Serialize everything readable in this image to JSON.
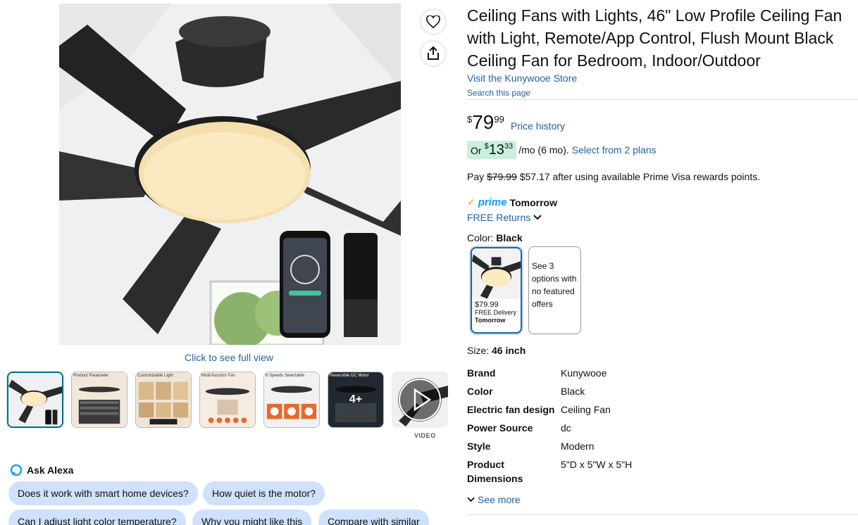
{
  "media": {
    "click_full_view": "Click to see full view",
    "thumbnails": [
      {
        "caption": ""
      },
      {
        "caption": "Product Parameter"
      },
      {
        "caption": "Customizable Light"
      },
      {
        "caption": "Multi-function Fan"
      },
      {
        "caption": "6 Speeds Selectable"
      },
      {
        "caption": "Reversible DC Motor",
        "overlay": "4+"
      },
      {
        "caption": ""
      }
    ],
    "video_label": "VIDEO"
  },
  "alexa": {
    "title": "Ask Alexa",
    "chips": [
      "Does it work with smart home devices?",
      "How quiet is the motor?",
      "Can I adjust light color temperature?",
      "Why you might like this",
      "Compare with similar"
    ]
  },
  "product": {
    "title": "Ceiling Fans with Lights, 46\" Low Profile Ceiling Fan with Light, Remote/App Control, Flush Mount Black Ceiling Fan for Bedroom, Indoor/Outdoor",
    "store_link": "Visit the Kunywooe Store",
    "search_page": "Search this page"
  },
  "pricing": {
    "currency": "$",
    "whole": "79",
    "fraction": "99",
    "price_history": "Price history",
    "monthly_prefix": "Or",
    "monthly_whole": "13",
    "monthly_fraction": "33",
    "monthly_term": "/mo (6 mo).",
    "monthly_plans": "Select from 2 plans",
    "visa_prefix": "Pay",
    "visa_old": "$79.99",
    "visa_text": "$57.17 after using available Prime Visa rewards points."
  },
  "delivery": {
    "prime_logo": "prime",
    "prime_when": "Tomorrow",
    "returns": "FREE Returns"
  },
  "color": {
    "label": "Color:",
    "value": "Black",
    "swatch_price": "$79.99",
    "swatch_delivery": "FREE Delivery",
    "swatch_when": "Tomorrow",
    "alt_options": "See 3 options with no featured offers"
  },
  "size": {
    "label": "Size:",
    "value": "46 inch"
  },
  "specs": [
    {
      "key": "Brand",
      "value": "Kunywooe"
    },
    {
      "key": "Color",
      "value": "Black"
    },
    {
      "key": "Electric fan design",
      "value": "Ceiling Fan"
    },
    {
      "key": "Power Source",
      "value": "dc"
    },
    {
      "key": "Style",
      "value": "Modern"
    },
    {
      "key": "Product Dimensions",
      "value": "5\"D x 5\"W x 5\"H"
    }
  ],
  "see_more": "See more",
  "colors": {
    "link": "#2162a1",
    "deal_highlight": "#c9f0dd",
    "chip": "#cfe1fb",
    "prime_blue": "#1399ff",
    "prime_check": "#ff9900"
  }
}
